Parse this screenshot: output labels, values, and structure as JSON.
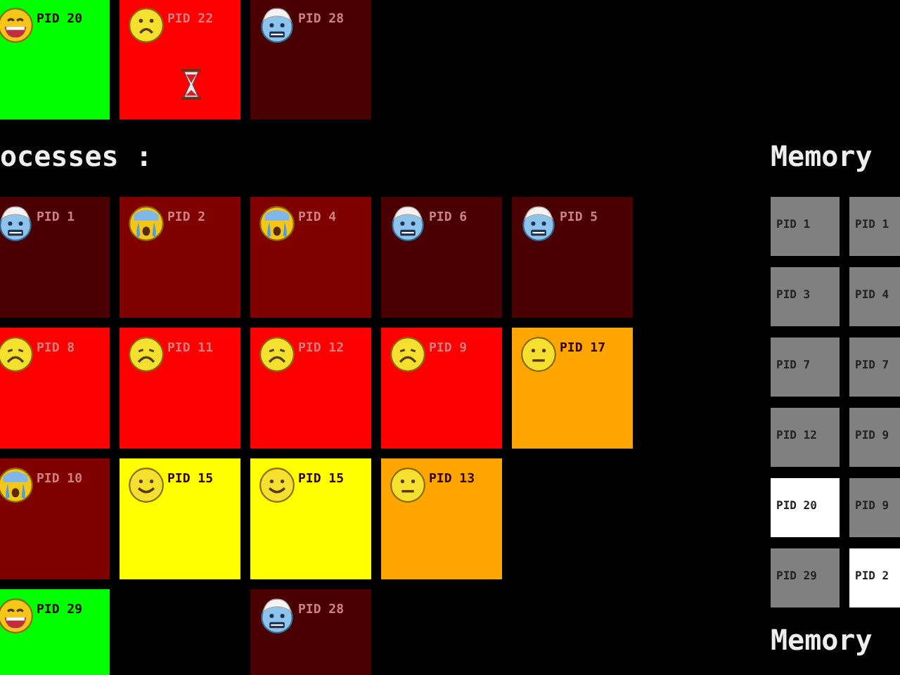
{
  "top_tiles": [
    {
      "label": "PID 20",
      "color": "#00ff00",
      "kind": "laughing",
      "waiting": false
    },
    {
      "label": "PID 22",
      "color": "#ff0000",
      "kind": "frowning",
      "waiting": true
    },
    {
      "label": "PID 28",
      "color": "#4a0000",
      "kind": "cold",
      "waiting": false
    }
  ],
  "heading": "ocesses :",
  "process_rows": [
    [
      {
        "label": "PID 1",
        "color": "#4a0000",
        "kind": "cold",
        "waiting": false
      },
      {
        "label": "PID 2",
        "color": "#800000",
        "kind": "crying",
        "waiting": false
      },
      {
        "label": "PID 4",
        "color": "#800000",
        "kind": "crying",
        "waiting": false
      },
      {
        "label": "PID 6",
        "color": "#4a0000",
        "kind": "cold",
        "waiting": false
      },
      {
        "label": "PID 5",
        "color": "#4a0000",
        "kind": "cold",
        "waiting": false
      }
    ],
    [
      {
        "label": "PID 8",
        "color": "#ff0000",
        "kind": "sad",
        "waiting": false
      },
      {
        "label": "PID 11",
        "color": "#ff0000",
        "kind": "sad",
        "waiting": false
      },
      {
        "label": "PID 12",
        "color": "#ff0000",
        "kind": "sad",
        "waiting": false
      },
      {
        "label": "PID 9",
        "color": "#ff0000",
        "kind": "sad",
        "waiting": false
      },
      {
        "label": "PID 17",
        "color": "#ffa500",
        "kind": "neutral",
        "waiting": false
      }
    ],
    [
      {
        "label": "PID 10",
        "color": "#800000",
        "kind": "crying",
        "waiting": false
      },
      {
        "label": "PID 15",
        "color": "#ffff00",
        "kind": "smiling",
        "waiting": false
      },
      {
        "label": "PID 15",
        "color": "#ffff00",
        "kind": "smiling",
        "waiting": false
      },
      {
        "label": "PID 13",
        "color": "#ffa500",
        "kind": "neutral",
        "waiting": false
      }
    ],
    [
      {
        "label": "PID 29",
        "color": "#00ff00",
        "kind": "laughing",
        "waiting": false
      },
      {
        "kind": "empty"
      },
      {
        "label": "PID 28",
        "color": "#4a0000",
        "kind": "cold",
        "waiting": false
      }
    ]
  ],
  "memory": {
    "title": "Memory",
    "cells": [
      {
        "label": "PID 1",
        "color": "#808080"
      },
      {
        "label": "PID 1",
        "color": "#808080"
      },
      {
        "label": "PID 3",
        "color": "#808080"
      },
      {
        "label": "PID 4",
        "color": "#808080"
      },
      {
        "label": "PID 7",
        "color": "#808080"
      },
      {
        "label": "PID 7",
        "color": "#808080"
      },
      {
        "label": "PID 12",
        "color": "#808080"
      },
      {
        "label": "PID 9",
        "color": "#808080"
      },
      {
        "label": "PID 20",
        "color": "#ffffff"
      },
      {
        "label": "PID 9",
        "color": "#808080"
      },
      {
        "label": "PID 29",
        "color": "#808080"
      },
      {
        "label": "PID 2",
        "color": "#ffffff"
      }
    ]
  },
  "memory_footer": "Memory"
}
